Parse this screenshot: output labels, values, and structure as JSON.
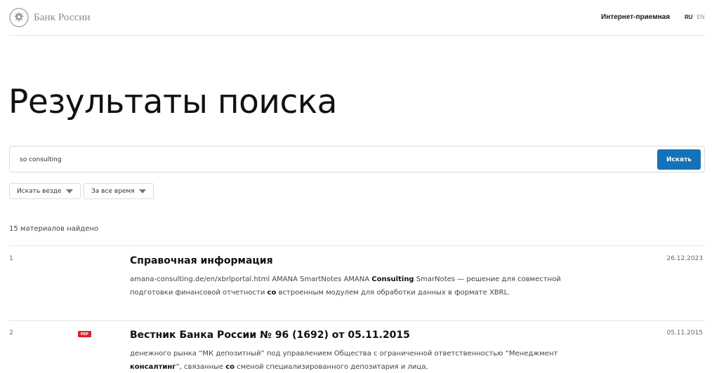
{
  "header": {
    "logo_text": "Банк России",
    "reception_link": "Интернет-приемная",
    "lang": {
      "ru": "RU",
      "en": "EN"
    }
  },
  "page_title": "Результаты поиска",
  "search": {
    "value": "so consulting",
    "button_label": "Искать"
  },
  "filters": {
    "where": "Искать везде",
    "time": "За все время"
  },
  "results_count": "15 материалов найдено",
  "results": [
    {
      "number": "1",
      "title": "Справочная информация",
      "date": "26.12.2023",
      "snippet": [
        {
          "t": "amana-consulting.de/en/xbrlportal.html AMANA SmartNotes AMANA ",
          "b": false
        },
        {
          "t": "Consulting",
          "b": true
        },
        {
          "t": " SmarNotes — решение для совместной подготовки финансовой отчетности ",
          "b": false
        },
        {
          "t": "со",
          "b": true
        },
        {
          "t": " встроенным модулем для обработки данных в формате XBRL.",
          "b": false
        }
      ]
    },
    {
      "number": "2",
      "badge": "PDF",
      "title": "Вестник Банка России № 96 (1692) от 05.11.2015",
      "date": "05.11.2015",
      "snippet": [
        {
          "t": "денежного рынка “МК депозитный” под управлением Общества с ограниченной ответственностью “Менеджмент ",
          "b": false
        },
        {
          "t": "консалтинг",
          "b": true
        },
        {
          "t": "”, связанные ",
          "b": false
        },
        {
          "t": "со",
          "b": true
        },
        {
          "t": " сменой специализированного депозитария и лица,",
          "b": false
        }
      ]
    }
  ]
}
